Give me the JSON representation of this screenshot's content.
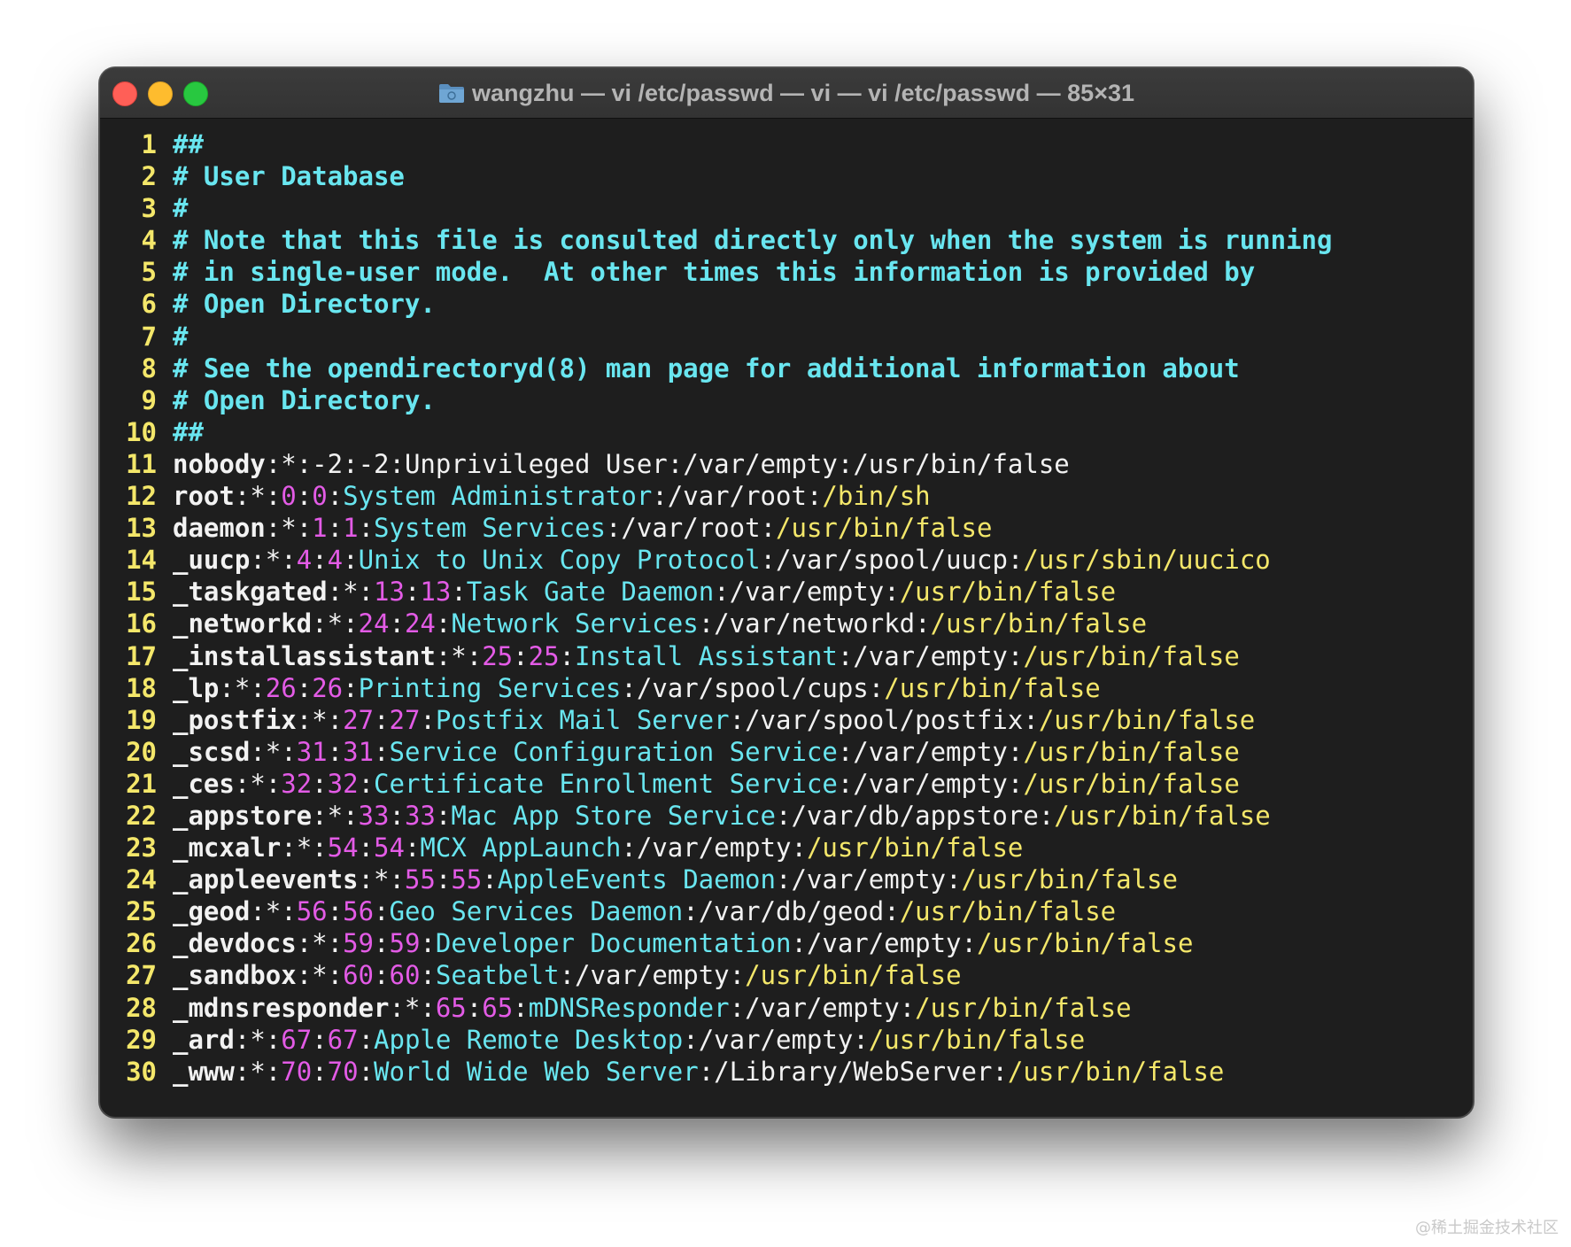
{
  "window": {
    "title": "wangzhu — vi /etc/passwd — vi — vi /etc/passwd — 85×31",
    "folder_icon": "folder-icon",
    "buttons": [
      "close",
      "minimize",
      "zoom"
    ]
  },
  "colors": {
    "comment": "#69e6f0",
    "line_number": "#f4e76a",
    "id_number": "#e35be6",
    "shell": "#f4e76a",
    "plain": "#f2f2f2",
    "background": "#1e1e1e"
  },
  "comments": [
    {
      "n": "1",
      "text": "##"
    },
    {
      "n": "2",
      "text": "# User Database"
    },
    {
      "n": "3",
      "text": "#"
    },
    {
      "n": "4",
      "text": "# Note that this file is consulted directly only when the system is running"
    },
    {
      "n": "5",
      "text": "# in single-user mode.  At other times this information is provided by"
    },
    {
      "n": "6",
      "text": "# Open Directory."
    },
    {
      "n": "7",
      "text": "#"
    },
    {
      "n": "8",
      "text": "# See the opendirectoryd(8) man page for additional information about"
    },
    {
      "n": "9",
      "text": "# Open Directory."
    },
    {
      "n": "10",
      "text": "##"
    }
  ],
  "entries": [
    {
      "n": "11",
      "user": "nobody",
      "pw": "*",
      "uid": "-2",
      "gid": "-2",
      "desc": "Unprivileged User",
      "home": "/var/empty",
      "shell": "/usr/bin/false",
      "plain": true
    },
    {
      "n": "12",
      "user": "root",
      "pw": "*",
      "uid": "0",
      "gid": "0",
      "desc": "System Administrator",
      "home": "/var/root",
      "shell": "/bin/sh"
    },
    {
      "n": "13",
      "user": "daemon",
      "pw": "*",
      "uid": "1",
      "gid": "1",
      "desc": "System Services",
      "home": "/var/root",
      "shell": "/usr/bin/false"
    },
    {
      "n": "14",
      "user": "_uucp",
      "pw": "*",
      "uid": "4",
      "gid": "4",
      "desc": "Unix to Unix Copy Protocol",
      "home": "/var/spool/uucp",
      "shell": "/usr/sbin/uucico"
    },
    {
      "n": "15",
      "user": "_taskgated",
      "pw": "*",
      "uid": "13",
      "gid": "13",
      "desc": "Task Gate Daemon",
      "home": "/var/empty",
      "shell": "/usr/bin/false"
    },
    {
      "n": "16",
      "user": "_networkd",
      "pw": "*",
      "uid": "24",
      "gid": "24",
      "desc": "Network Services",
      "home": "/var/networkd",
      "shell": "/usr/bin/false"
    },
    {
      "n": "17",
      "user": "_installassistant",
      "pw": "*",
      "uid": "25",
      "gid": "25",
      "desc": "Install Assistant",
      "home": "/var/empty",
      "shell": "/usr/bin/false"
    },
    {
      "n": "18",
      "user": "_lp",
      "pw": "*",
      "uid": "26",
      "gid": "26",
      "desc": "Printing Services",
      "home": "/var/spool/cups",
      "shell": "/usr/bin/false"
    },
    {
      "n": "19",
      "user": "_postfix",
      "pw": "*",
      "uid": "27",
      "gid": "27",
      "desc": "Postfix Mail Server",
      "home": "/var/spool/postfix",
      "shell": "/usr/bin/false"
    },
    {
      "n": "20",
      "user": "_scsd",
      "pw": "*",
      "uid": "31",
      "gid": "31",
      "desc": "Service Configuration Service",
      "home": "/var/empty",
      "shell": "/usr/bin/false"
    },
    {
      "n": "21",
      "user": "_ces",
      "pw": "*",
      "uid": "32",
      "gid": "32",
      "desc": "Certificate Enrollment Service",
      "home": "/var/empty",
      "shell": "/usr/bin/false"
    },
    {
      "n": "22",
      "user": "_appstore",
      "pw": "*",
      "uid": "33",
      "gid": "33",
      "desc": "Mac App Store Service",
      "home": "/var/db/appstore",
      "shell": "/usr/bin/false"
    },
    {
      "n": "23",
      "user": "_mcxalr",
      "pw": "*",
      "uid": "54",
      "gid": "54",
      "desc": "MCX AppLaunch",
      "home": "/var/empty",
      "shell": "/usr/bin/false"
    },
    {
      "n": "24",
      "user": "_appleevents",
      "pw": "*",
      "uid": "55",
      "gid": "55",
      "desc": "AppleEvents Daemon",
      "home": "/var/empty",
      "shell": "/usr/bin/false"
    },
    {
      "n": "25",
      "user": "_geod",
      "pw": "*",
      "uid": "56",
      "gid": "56",
      "desc": "Geo Services Daemon",
      "home": "/var/db/geod",
      "shell": "/usr/bin/false"
    },
    {
      "n": "26",
      "user": "_devdocs",
      "pw": "*",
      "uid": "59",
      "gid": "59",
      "desc": "Developer Documentation",
      "home": "/var/empty",
      "shell": "/usr/bin/false"
    },
    {
      "n": "27",
      "user": "_sandbox",
      "pw": "*",
      "uid": "60",
      "gid": "60",
      "desc": "Seatbelt",
      "home": "/var/empty",
      "shell": "/usr/bin/false"
    },
    {
      "n": "28",
      "user": "_mdnsresponder",
      "pw": "*",
      "uid": "65",
      "gid": "65",
      "desc": "mDNSResponder",
      "home": "/var/empty",
      "shell": "/usr/bin/false"
    },
    {
      "n": "29",
      "user": "_ard",
      "pw": "*",
      "uid": "67",
      "gid": "67",
      "desc": "Apple Remote Desktop",
      "home": "/var/empty",
      "shell": "/usr/bin/false"
    },
    {
      "n": "30",
      "user": "_www",
      "pw": "*",
      "uid": "70",
      "gid": "70",
      "desc": "World Wide Web Server",
      "home": "/Library/WebServer",
      "shell": "/usr/bin/false"
    }
  ],
  "watermark": "@稀土掘金技术社区"
}
